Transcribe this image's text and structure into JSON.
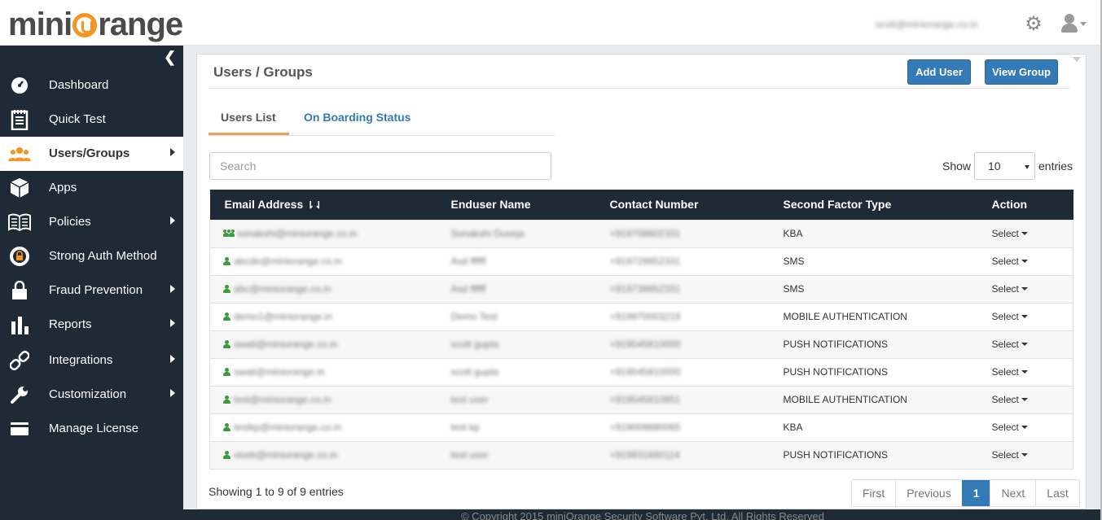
{
  "header": {
    "logo": {
      "part1": "mini",
      "part2": "range"
    },
    "user_email": "scott@miniorange.co.in"
  },
  "sidebar": {
    "items": [
      {
        "label": "Dashboard",
        "icon": "dashboard-gauge-icon",
        "arrow": false,
        "active": false
      },
      {
        "label": "Quick Test",
        "icon": "notepad-icon",
        "arrow": false,
        "active": false
      },
      {
        "label": "Users/Groups",
        "icon": "users-icon",
        "arrow": true,
        "active": true
      },
      {
        "label": "Apps",
        "icon": "cube-icon",
        "arrow": false,
        "active": false
      },
      {
        "label": "Policies",
        "icon": "book-icon",
        "arrow": true,
        "active": false
      },
      {
        "label": "Strong Auth Method",
        "icon": "lock-badge-icon",
        "arrow": false,
        "active": false
      },
      {
        "label": "Fraud Prevention",
        "icon": "padlock-icon",
        "arrow": true,
        "active": false
      },
      {
        "label": "Reports",
        "icon": "bar-chart-icon",
        "arrow": true,
        "active": false
      },
      {
        "label": "Integrations",
        "icon": "link-icon",
        "arrow": true,
        "active": false
      },
      {
        "label": "Customization",
        "icon": "wrench-icon",
        "arrow": true,
        "active": false
      },
      {
        "label": "Manage License",
        "icon": "credit-card-icon",
        "arrow": false,
        "active": false
      }
    ]
  },
  "main": {
    "title": "Users / Groups",
    "add_user_label": "Add User",
    "view_group_label": "View Group",
    "tabs": [
      {
        "label": "Users List",
        "active": true
      },
      {
        "label": "On Boarding Status",
        "active": false
      }
    ],
    "search": {
      "placeholder": "Search",
      "value": ""
    },
    "length": {
      "show_label": "Show",
      "value": "10",
      "entries_label": "entries"
    },
    "table": {
      "columns": [
        "Email Address",
        "Enduser Name",
        "Contact Number",
        "Second Factor Type",
        "Action"
      ],
      "rows": [
        {
          "email": "sonakshi@miniorange.co.in",
          "name": "Sonakshi Duseja",
          "contact": "+919708802331",
          "factor": "KBA",
          "action": "Select",
          "icon": "group"
        },
        {
          "email": "abcde@miniorange.co.in",
          "name": "Asd ffffff",
          "contact": "+919729852331",
          "factor": "SMS",
          "action": "Select",
          "icon": "person"
        },
        {
          "email": "abc@miniorange.co.in",
          "name": "Asd ffffff",
          "contact": "+919738852331",
          "factor": "SMS",
          "action": "Select",
          "icon": "person"
        },
        {
          "email": "demo1@miniorange.in",
          "name": "Demo Test",
          "contact": "+919970003219",
          "factor": "MOBILE AUTHENTICATION",
          "action": "Select",
          "icon": "person"
        },
        {
          "email": "swati@miniorange.co.in",
          "name": "scott gupta",
          "contact": "+919545810000",
          "factor": "PUSH NOTIFICATIONS",
          "action": "Select",
          "icon": "person"
        },
        {
          "email": "swati@miniorange.in",
          "name": "scott gupta",
          "contact": "+919545810000",
          "factor": "PUSH NOTIFICATIONS",
          "action": "Select",
          "icon": "person"
        },
        {
          "email": "test@miniorange.co.in",
          "name": "test user",
          "contact": "+919545810851",
          "factor": "MOBILE AUTHENTICATION",
          "action": "Select",
          "icon": "person"
        },
        {
          "email": "testkp@miniorange.co.in",
          "name": "test kp",
          "contact": "+919009880065",
          "factor": "KBA",
          "action": "Select",
          "icon": "person"
        },
        {
          "email": "vivek@miniorange.co.in",
          "name": "test user",
          "contact": "+919931660114",
          "factor": "PUSH NOTIFICATIONS",
          "action": "Select",
          "icon": "person"
        }
      ]
    },
    "info": "Showing 1 to 9 of 9 entries",
    "pagination": [
      "First",
      "Previous",
      "1",
      "Next",
      "Last"
    ],
    "current_page": "1"
  },
  "footer": "© Copyright 2015 miniOrange Security Software Pvt. Ltd. All Rights Reserved"
}
